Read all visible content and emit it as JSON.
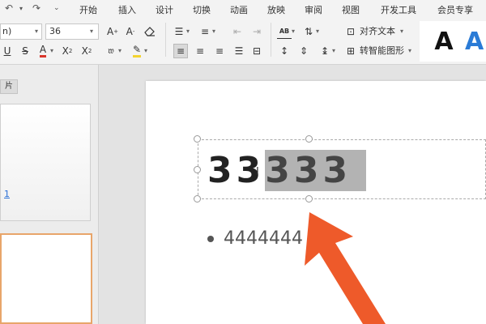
{
  "menubar": {
    "tabs": [
      "开始",
      "插入",
      "设计",
      "切换",
      "动画",
      "放映",
      "审阅",
      "视图",
      "开发工具",
      "会员专享"
    ]
  },
  "ribbon": {
    "font_name": "n)",
    "font_size": "36",
    "align_text_label": "对齐文本",
    "smartart_label": "转智能图形",
    "wordart_char": "A",
    "highlight_color": "#2a7bd6",
    "font_color_underline": "#d9362b",
    "highlighter_color": "#f3d330"
  },
  "left_panel": {
    "tab_label": "片",
    "thumb1_number": "1"
  },
  "slide": {
    "title_plain": "33",
    "title_selected": "333",
    "bullet_text": "4444444"
  },
  "colors": {
    "arrow": "#ee5a2a",
    "selection": "#b3b3b3"
  }
}
